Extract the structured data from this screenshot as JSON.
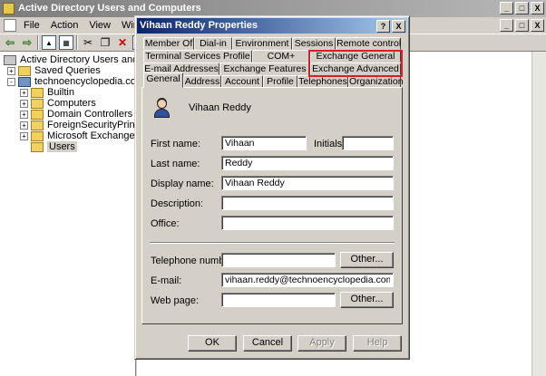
{
  "main_window": {
    "title": "Active Directory Users and Computers",
    "menu": [
      "File",
      "Action",
      "View",
      "Window"
    ],
    "toolbar_icons": [
      "back-arrow-icon",
      "forward-arrow-icon",
      "up-folder-icon",
      "console-tree-icon",
      "cut-icon",
      "copy-icon",
      "delete-icon",
      "properties-icon"
    ],
    "window_controls": [
      "_",
      "□",
      "X"
    ],
    "mdi_controls": [
      "_",
      "□",
      "X"
    ]
  },
  "tree": {
    "items": [
      {
        "label": "Active Directory Users and Comput",
        "expander": "",
        "icon": "root"
      },
      {
        "label": "Saved Queries",
        "expander": "+",
        "icon": "folder"
      },
      {
        "label": "technoencyclopedia.com",
        "expander": "-",
        "icon": "domain"
      },
      {
        "label": "Builtin",
        "expander": "+",
        "icon": "folder"
      },
      {
        "label": "Computers",
        "expander": "+",
        "icon": "folder"
      },
      {
        "label": "Domain Controllers",
        "expander": "+",
        "icon": "folder"
      },
      {
        "label": "ForeignSecurityPrincipals",
        "expander": "+",
        "icon": "folder"
      },
      {
        "label": "Microsoft Exchange Securit",
        "expander": "+",
        "icon": "folder"
      },
      {
        "label": "Users",
        "expander": "",
        "icon": "folder"
      }
    ]
  },
  "dialog": {
    "title": "Vihaan Reddy Properties",
    "title_buttons": [
      "?",
      "X"
    ],
    "tabs_row1": [
      "Member Of",
      "Dial-in",
      "Environment",
      "Sessions",
      "Remote control"
    ],
    "tabs_row2": [
      "Terminal Services Profile",
      "COM+",
      "Exchange General"
    ],
    "tabs_row3": [
      "E-mail Addresses",
      "Exchange Features",
      "Exchange Advanced"
    ],
    "tabs_row4": [
      "General",
      "Address",
      "Account",
      "Profile",
      "Telephones",
      "Organization"
    ],
    "display_header": "Vihaan Reddy",
    "fields": {
      "first_name_label": "First name:",
      "first_name": "Vihaan",
      "initials_label": "Initials:",
      "initials": "",
      "last_name_label": "Last name:",
      "last_name": "Reddy",
      "display_name_label": "Display name:",
      "display_name": "Vihaan Reddy",
      "description_label": "Description:",
      "description": "",
      "office_label": "Office:",
      "office": "",
      "telephone_label": "Telephone number:",
      "telephone": "",
      "email_label": "E-mail:",
      "email": "vihaan.reddy@technoencyclopedia.com",
      "web_page_label": "Web page:",
      "web_page": ""
    },
    "other_button": "Other...",
    "buttons": {
      "ok": "OK",
      "cancel": "Cancel",
      "apply": "Apply",
      "help": "Help"
    }
  }
}
